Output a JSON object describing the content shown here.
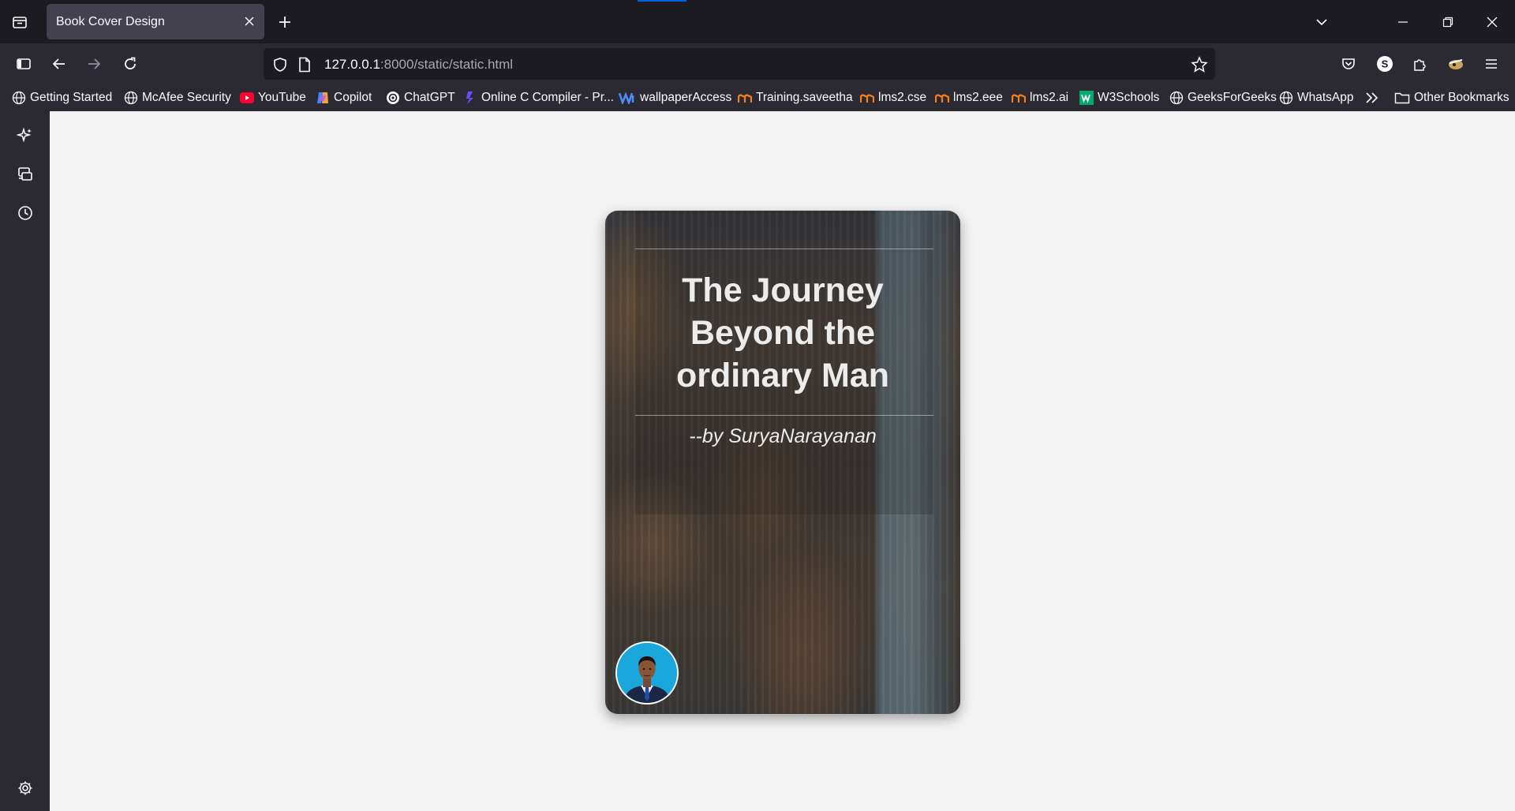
{
  "browser": {
    "tab": {
      "title": "Book Cover Design"
    },
    "url": {
      "host": "127.0.0.1",
      "rest": ":8000/static/static.html"
    },
    "bookmarks": [
      {
        "label": "Getting Started",
        "icon": "globe-icon"
      },
      {
        "label": "McAfee Security",
        "icon": "globe-icon"
      },
      {
        "label": "YouTube",
        "icon": "youtube-icon"
      },
      {
        "label": "Copilot",
        "icon": "copilot-icon"
      },
      {
        "label": "ChatGPT",
        "icon": "chatgpt-icon"
      },
      {
        "label": "Online C Compiler - Pr...",
        "icon": "compiler-icon"
      },
      {
        "label": "wallpaperAccess",
        "icon": "wallpaperaccess-icon"
      },
      {
        "label": "Training.saveetha",
        "icon": "moodle-icon"
      },
      {
        "label": "lms2.cse",
        "icon": "moodle-icon"
      },
      {
        "label": "lms2.eee",
        "icon": "moodle-icon"
      },
      {
        "label": "lms2.ai",
        "icon": "moodle-icon"
      },
      {
        "label": "W3Schools",
        "icon": "w3schools-icon"
      },
      {
        "label": "GeeksForGeeks",
        "icon": "globe-icon"
      },
      {
        "label": "WhatsApp",
        "icon": "globe-icon"
      }
    ],
    "other_bookmarks": "Other Bookmarks"
  },
  "cover": {
    "title_lines": [
      "The Journey",
      "Beyond the",
      "ordinary Man"
    ],
    "author": "--by SuryaNarayanan"
  }
}
